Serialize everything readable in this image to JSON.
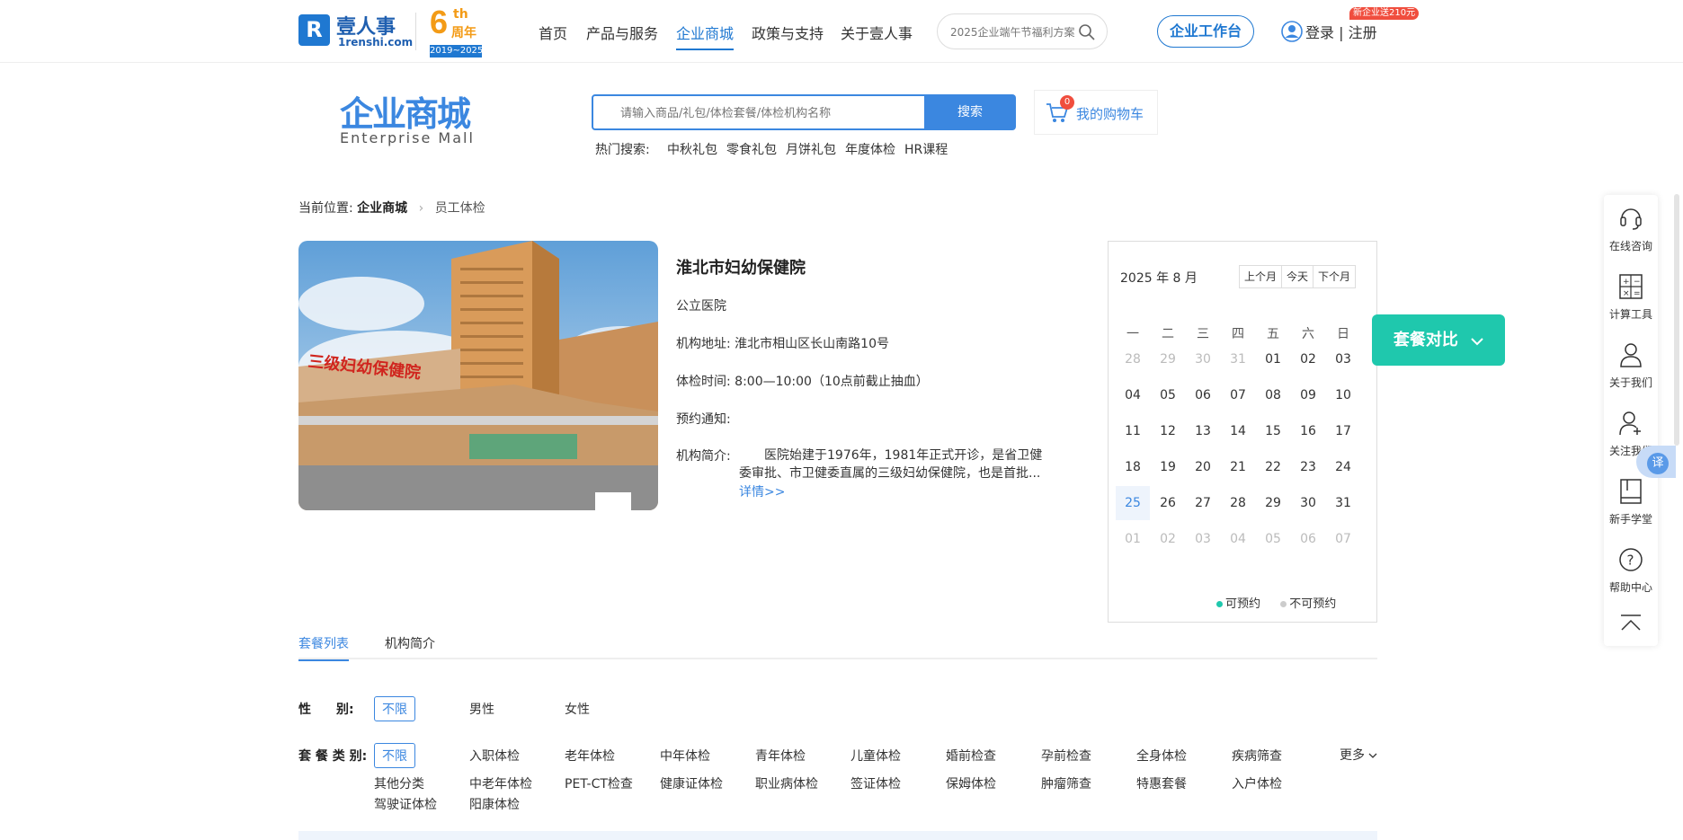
{
  "header": {
    "logo_cn": "壹人事",
    "logo_en": "1renshi.com",
    "anniv_big": "6",
    "anniv_th": "th",
    "anniv_zn": "周年",
    "anniv_years": "2019~2025",
    "nav": [
      "首页",
      "产品与服务",
      "企业商城",
      "政策与支持",
      "关于壹人事"
    ],
    "active_nav": "企业商城",
    "search_placeholder": "2025企业端午节福利方案",
    "workbench": "企业工作台",
    "login": "登录 | 注册",
    "promo": "新企业送210元"
  },
  "mall": {
    "title_cn": "企业商城",
    "title_en": "Enterprise  Mall",
    "search_placeholder": "请输入商品/礼包/体检套餐/体检机构名称",
    "search_button": "搜索",
    "cart_count": "0",
    "cart_label": "我的购物车",
    "hot_label": "热门搜索:",
    "hot_items": [
      "中秋礼包",
      "零食礼包",
      "月饼礼包",
      "年度体检",
      "HR课程"
    ]
  },
  "breadcrumb": {
    "prefix": "当前位置:",
    "level1": "企业商城",
    "level2": "员工体检"
  },
  "hospital": {
    "name": "淮北市妇幼保健院",
    "type": "公立医院",
    "address_label": "机构地址:",
    "address": "淮北市相山区长山南路10号",
    "time_label": "体检时间:",
    "time": "8:00—10:00（10点前截止抽血）",
    "notice_label": "预约通知:",
    "notice": "",
    "intro_label": "机构简介:",
    "intro": "医院始建于1976年，1981年正式开诊，是省卫健委审批、市卫健委直属的三级妇幼保健院，也是首批...",
    "more": "详情>>",
    "photo_sign": "三级妇幼保健院"
  },
  "calendar": {
    "title": "2025 年 8 月",
    "prev": "上个月",
    "today": "今天",
    "next": "下个月",
    "weekdays": [
      "一",
      "二",
      "三",
      "四",
      "五",
      "六",
      "日"
    ],
    "days": [
      [
        "28",
        "29",
        "30",
        "31",
        "01",
        "02",
        "03"
      ],
      [
        "04",
        "05",
        "06",
        "07",
        "08",
        "09",
        "10"
      ],
      [
        "11",
        "12",
        "13",
        "14",
        "15",
        "16",
        "17"
      ],
      [
        "18",
        "19",
        "20",
        "21",
        "22",
        "23",
        "24"
      ],
      [
        "25",
        "26",
        "27",
        "28",
        "29",
        "30",
        "31"
      ],
      [
        "01",
        "02",
        "03",
        "04",
        "05",
        "06",
        "07"
      ]
    ],
    "selected": "25",
    "legend_available": "可预约",
    "legend_unavailable": "不可预约",
    "available_color": "#1fc8ad",
    "unavailable_color": "#cccccc"
  },
  "compare_button": "套餐对比",
  "side_tools": [
    "在线咨询",
    "计算工具",
    "关于我们",
    "关注我们",
    "新手学堂",
    "帮助中心"
  ],
  "translate": "译",
  "tabs": [
    "套餐列表",
    "机构简介"
  ],
  "filters": {
    "gender_label": "性　　别:",
    "gender_options": [
      "不限",
      "男性",
      "女性"
    ],
    "category_label": "套 餐 类 别:",
    "category_row1": [
      "不限",
      "入职体检",
      "老年体检",
      "中年体检",
      "青年体检",
      "儿童体检",
      "婚前检查",
      "孕前检查",
      "全身体检",
      "疾病筛查"
    ],
    "category_row2": [
      "其他分类",
      "中老年体检",
      "PET-CT检查",
      "健康证体检",
      "职业病体检",
      "签证体检",
      "保姆体检",
      "肿瘤筛查",
      "特惠套餐",
      "入户体检"
    ],
    "category_row3": [
      "驾驶证体检",
      "阳康体检"
    ],
    "more": "更多"
  },
  "colors": {
    "brand": "#1f78d1",
    "accent": "#3b87e0",
    "compare": "#1fc8ad",
    "promo": "#f04e3e"
  }
}
